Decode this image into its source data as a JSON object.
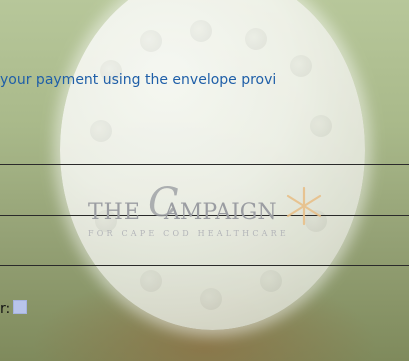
{
  "instruction": "your payment using the envelope provi",
  "logo": {
    "the": "THE",
    "c": "C",
    "campaign": "AMPAIGN",
    "sub": "FOR CAPE COD HEALTHCARE"
  },
  "checkbox_label": "r:"
}
